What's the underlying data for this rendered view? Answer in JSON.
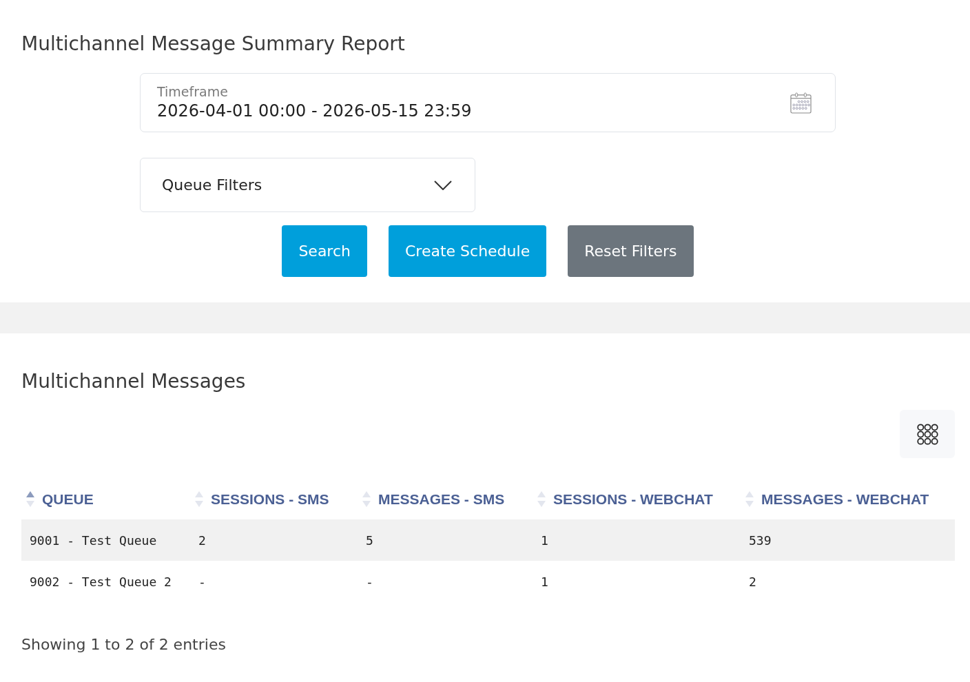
{
  "page": {
    "title": "Multichannel Message Summary Report"
  },
  "filters": {
    "timeframe": {
      "label": "Timeframe",
      "value": "2026-04-01 00:00 - 2026-05-15 23:59"
    },
    "queue_filters": {
      "label": "Queue Filters",
      "expanded": false
    }
  },
  "buttons": [
    {
      "label": "Search",
      "kind": "primary"
    },
    {
      "label": "Create Schedule",
      "kind": "primary"
    },
    {
      "label": "Reset Filters",
      "kind": "secondary"
    }
  ],
  "results": {
    "title": "Multichannel Messages",
    "table": {
      "columns": [
        {
          "label": "QUEUE",
          "sorted": true
        },
        {
          "label": "SESSIONS - SMS",
          "sorted": false
        },
        {
          "label": "MESSAGES - SMS",
          "sorted": false
        },
        {
          "label": "SESSIONS - WEBCHAT",
          "sorted": false
        },
        {
          "label": "MESSAGES - WEBCHAT",
          "sorted": false
        }
      ],
      "rows": [
        {
          "cells": [
            "9001 - Test Queue",
            "2",
            "5",
            "1",
            "539"
          ]
        },
        {
          "cells": [
            "9002 - Test Queue 2",
            "-",
            "-",
            "1",
            "2"
          ]
        }
      ]
    },
    "info": "Showing 1 to 2 of 2 entries"
  }
}
